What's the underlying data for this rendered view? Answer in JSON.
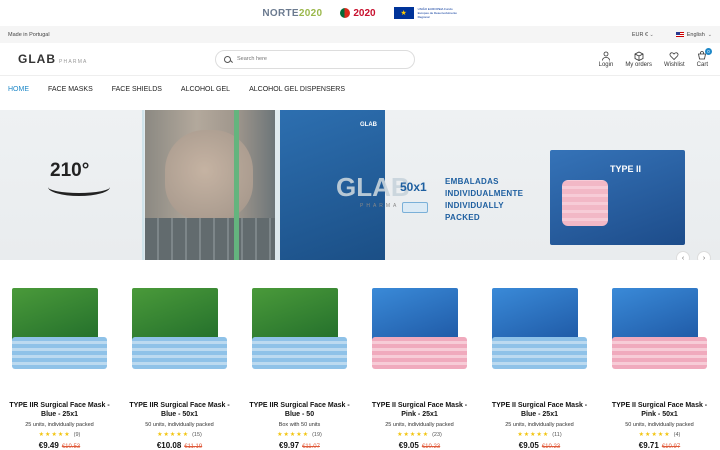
{
  "funding": {
    "norte_a": "NORTE",
    "norte_b": "2020",
    "portugal": "2020",
    "eu_text": "UNIÃO EUROPEIA Fundo Europeu de Desenvolvimento Regional"
  },
  "topbar": {
    "made_in": "Made in Portugal",
    "currency": "EUR €",
    "language": "English"
  },
  "header": {
    "logo": "GLAB",
    "logo_sub": "PHARMA",
    "search_placeholder": "Search here",
    "actions": [
      {
        "label": "Login",
        "icon": "user-icon"
      },
      {
        "label": "My orders",
        "icon": "box-icon"
      },
      {
        "label": "Wishlist",
        "icon": "heart-icon"
      },
      {
        "label": "Cart",
        "icon": "cart-icon",
        "badge": "0"
      }
    ]
  },
  "nav": [
    "HOME",
    "FACE MASKS",
    "FACE SHIELDS",
    "ALCOHOL GEL",
    "ALCOHOL GEL DISPENSERS"
  ],
  "hero": {
    "angle": "210°",
    "brand": "GLAB",
    "brand_sub": "PHARMA",
    "units": "50x1",
    "text_line1": "EMBALADAS",
    "text_line2": "INDIVIDUALMENTE",
    "text_line3": "INDIVIDUALLY",
    "text_line4": "PACKED",
    "box_type": "TYPE II",
    "prev": "‹",
    "next": "›"
  },
  "products": [
    {
      "title": "TYPE IIR Surgical Face Mask - Blue - 25x1",
      "desc": "25 units, individually packed",
      "rating": 5,
      "reviews": "(9)",
      "price": "€9.49",
      "old": "€10.53",
      "color": "green",
      "mask": "blue"
    },
    {
      "title": "TYPE IIR Surgical Face Mask - Blue - 50x1",
      "desc": "50 units, individually packed",
      "rating": 5,
      "reviews": "(15)",
      "price": "€10.08",
      "old": "€11.19",
      "color": "green",
      "mask": "blue"
    },
    {
      "title": "TYPE IIR Surgical Face Mask - Blue - 50",
      "desc": "Box with 50 units",
      "rating": 5,
      "reviews": "(19)",
      "price": "€9.97",
      "old": "€11.07",
      "color": "green",
      "mask": "blue"
    },
    {
      "title": "TYPE II Surgical Face Mask - Pink - 25x1",
      "desc": "25 units, individually packed",
      "rating": 5,
      "reviews": "(23)",
      "price": "€9.05",
      "old": "€10.23",
      "color": "blue",
      "mask": "pink"
    },
    {
      "title": "TYPE II Surgical Face Mask - Blue - 25x1",
      "desc": "25 units, individually packed",
      "rating": 5,
      "reviews": "(11)",
      "price": "€9.05",
      "old": "€10.23",
      "color": "blue",
      "mask": "blue"
    },
    {
      "title": "TYPE II Surgical Face Mask - Pink - 50x1",
      "desc": "50 units, individually packed",
      "rating": 5,
      "reviews": "(4)",
      "price": "€9.71",
      "old": "€10.97",
      "color": "blue",
      "mask": "pink"
    }
  ]
}
